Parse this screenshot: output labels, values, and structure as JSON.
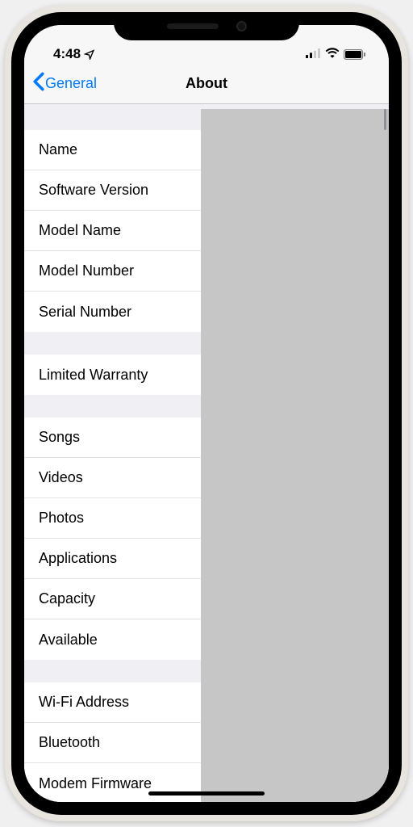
{
  "statusBar": {
    "time": "4:48"
  },
  "nav": {
    "backLabel": "General",
    "title": "About"
  },
  "groups": {
    "info": {
      "name": "Name",
      "software": "Software Version",
      "modelName": "Model Name",
      "modelNumber": "Model Number",
      "serial": "Serial Number"
    },
    "warranty": {
      "limited": "Limited Warranty"
    },
    "media": {
      "songs": "Songs",
      "videos": "Videos",
      "photos": "Photos",
      "apps": "Applications",
      "capacity": "Capacity",
      "available": "Available"
    },
    "network": {
      "wifi": "Wi-Fi Address",
      "bluetooth": "Bluetooth",
      "modem": "Modem Firmware"
    }
  }
}
